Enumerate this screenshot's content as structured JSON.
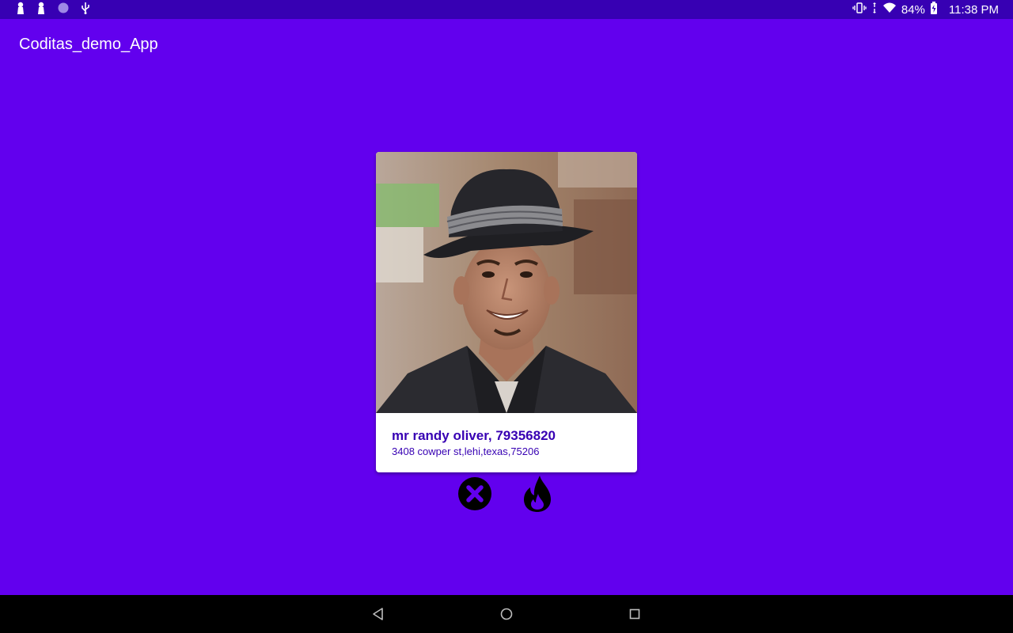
{
  "status_bar": {
    "battery_percent": "84%",
    "time": "11:38 PM",
    "left_icons": [
      "notification-icon",
      "notification-icon",
      "circle-icon",
      "usb-icon"
    ],
    "right_icons": [
      "vibrate-icon",
      "data-arrows-icon",
      "wifi-icon",
      "battery-charging-icon"
    ]
  },
  "app_bar": {
    "title": "Coditas_demo_App"
  },
  "card": {
    "name_line": "mr randy oliver, 79356820",
    "address": "3408 cowper st,lehi,texas,75206"
  },
  "actions": {
    "reject_icon": "close-icon",
    "like_icon": "fire-icon"
  },
  "nav_bar": {
    "icons": [
      "back-icon",
      "home-icon",
      "recents-icon"
    ]
  },
  "colors": {
    "primary": "#6200ee",
    "primary_dark": "#3700b3",
    "card_text": "#3700b3",
    "nav_background": "#000000"
  }
}
